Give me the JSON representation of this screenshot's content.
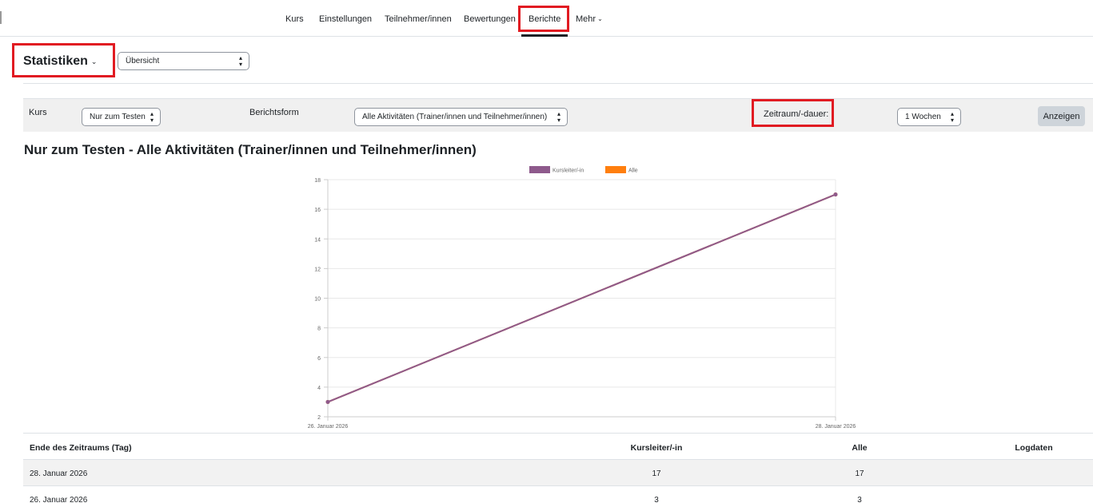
{
  "nav": {
    "tabs": [
      "Kurs",
      "Einstellungen",
      "Teilnehmer/innen",
      "Bewertungen",
      "Berichte",
      "Mehr"
    ],
    "active": "Berichte"
  },
  "statistics": {
    "title": "Statistiken",
    "view_select": "Übersicht"
  },
  "filters": {
    "kurs_label": "Kurs",
    "kurs_value": "Nur zum Testen",
    "berichtsform_label": "Berichtsform",
    "berichtsform_value": "Alle Aktivitäten (Trainer/innen und Teilnehmer/innen)",
    "zeitraum_label": "Zeitraum/-dauer:",
    "zeitraum_value": "1 Wochen",
    "submit_label": "Anzeigen"
  },
  "report": {
    "title": "Nur zum Testen - Alle Aktivitäten (Trainer/innen und Teilnehmer/innen)"
  },
  "chart_data": {
    "type": "line",
    "x": [
      "26. Januar 2026",
      "28. Januar 2026"
    ],
    "series": [
      {
        "name": "Kursleiter/-in",
        "values": [
          3,
          17
        ],
        "color": "#8e5a8c"
      },
      {
        "name": "Alle",
        "values": [
          3,
          17
        ],
        "color": "#ff7f0e"
      }
    ],
    "ylim": [
      2,
      18
    ],
    "yticks": [
      2,
      4,
      6,
      8,
      10,
      12,
      14,
      16,
      18
    ],
    "legend": "top",
    "grid": true
  },
  "table": {
    "headers": [
      "Ende des Zeitraums (Tag)",
      "Kursleiter/-in",
      "Alle",
      "Logdaten"
    ],
    "rows": [
      [
        "28. Januar 2026",
        "17",
        "17",
        ""
      ],
      [
        "26. Januar 2026",
        "3",
        "3",
        ""
      ]
    ]
  },
  "colors": {
    "highlight": "#e11b22",
    "series_kursleiter": "#8e5a8c",
    "series_alle": "#ff7f0e"
  }
}
